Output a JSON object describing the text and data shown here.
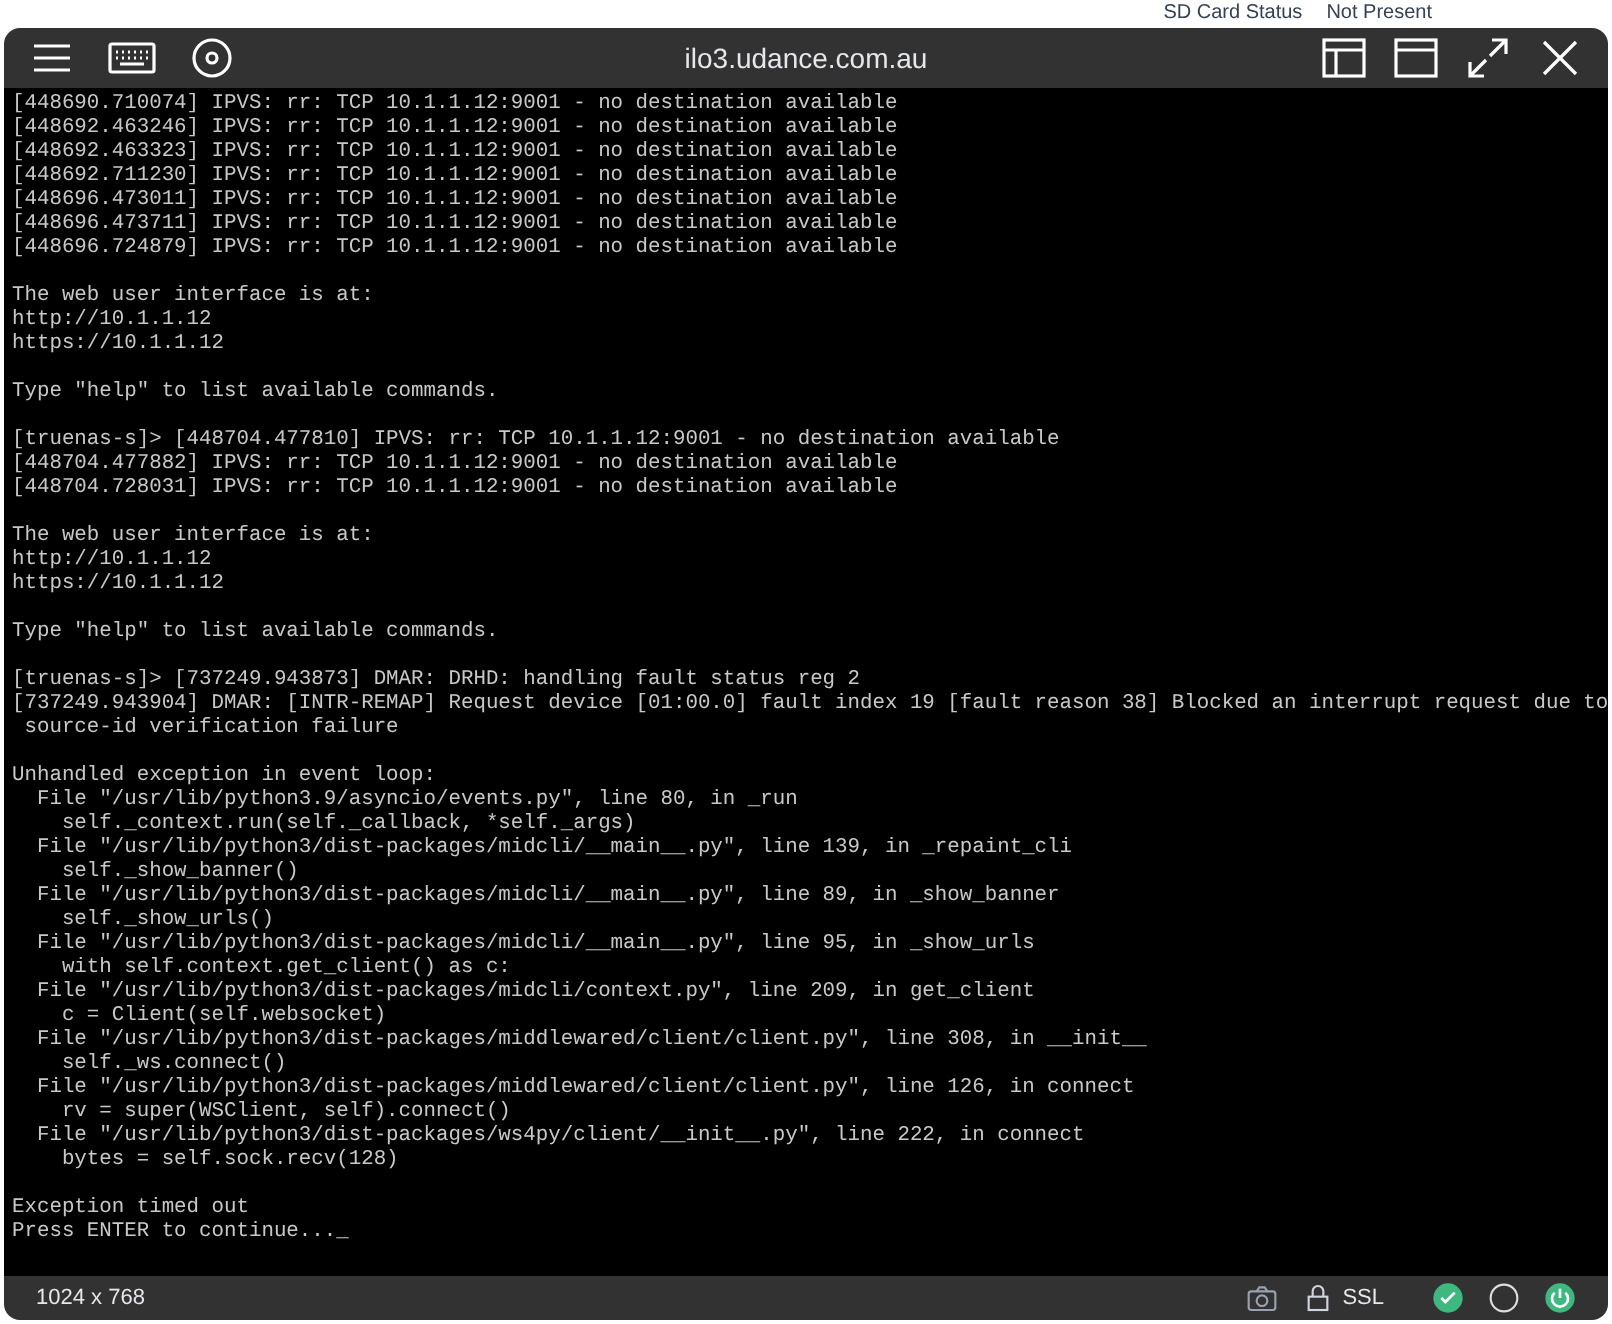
{
  "background_page": {
    "label": "SD Card Status",
    "value": "Not Present"
  },
  "window": {
    "title": "ilo3.udance.com.au"
  },
  "console": {
    "blocks": [
      [
        "[448690.710074] IPVS: rr: TCP 10.1.1.12:9001 - no destination available",
        "[448692.463246] IPVS: rr: TCP 10.1.1.12:9001 - no destination available",
        "[448692.463323] IPVS: rr: TCP 10.1.1.12:9001 - no destination available",
        "[448692.711230] IPVS: rr: TCP 10.1.1.12:9001 - no destination available",
        "[448696.473011] IPVS: rr: TCP 10.1.1.12:9001 - no destination available",
        "[448696.473711] IPVS: rr: TCP 10.1.1.12:9001 - no destination available",
        "[448696.724879] IPVS: rr: TCP 10.1.1.12:9001 - no destination available"
      ],
      [
        "The web user interface is at:",
        "http://10.1.1.12",
        "https://10.1.1.12"
      ],
      [
        "Type \"help\" to list available commands."
      ],
      [
        "[truenas-s]> [448704.477810] IPVS: rr: TCP 10.1.1.12:9001 - no destination available",
        "[448704.477882] IPVS: rr: TCP 10.1.1.12:9001 - no destination available",
        "[448704.728031] IPVS: rr: TCP 10.1.1.12:9001 - no destination available"
      ],
      [
        "The web user interface is at:",
        "http://10.1.1.12",
        "https://10.1.1.12"
      ],
      [
        "Type \"help\" to list available commands."
      ],
      [
        "[truenas-s]> [737249.943873] DMAR: DRHD: handling fault status reg 2",
        "[737249.943904] DMAR: [INTR-REMAP] Request device [01:00.0] fault index 19 [fault reason 38] Blocked an interrupt request due to",
        " source-id verification failure"
      ],
      [
        "Unhandled exception in event loop:",
        "  File \"/usr/lib/python3.9/asyncio/events.py\", line 80, in _run",
        "    self._context.run(self._callback, *self._args)",
        "  File \"/usr/lib/python3/dist-packages/midcli/__main__.py\", line 139, in _repaint_cli",
        "    self._show_banner()",
        "  File \"/usr/lib/python3/dist-packages/midcli/__main__.py\", line 89, in _show_banner",
        "    self._show_urls()",
        "  File \"/usr/lib/python3/dist-packages/midcli/__main__.py\", line 95, in _show_urls",
        "    with self.context.get_client() as c:",
        "  File \"/usr/lib/python3/dist-packages/midcli/context.py\", line 209, in get_client",
        "    c = Client(self.websocket)",
        "  File \"/usr/lib/python3/dist-packages/middlewared/client/client.py\", line 308, in __init__",
        "    self._ws.connect()",
        "  File \"/usr/lib/python3/dist-packages/middlewared/client/client.py\", line 126, in connect",
        "    rv = super(WSClient, self).connect()",
        "  File \"/usr/lib/python3/dist-packages/ws4py/client/__init__.py\", line 222, in connect",
        "    bytes = self.sock.recv(128)"
      ],
      [
        "Exception timed out",
        "Press ENTER to continue..._"
      ]
    ]
  },
  "status_bar": {
    "resolution": "1024 x 768",
    "security": "SSL"
  }
}
